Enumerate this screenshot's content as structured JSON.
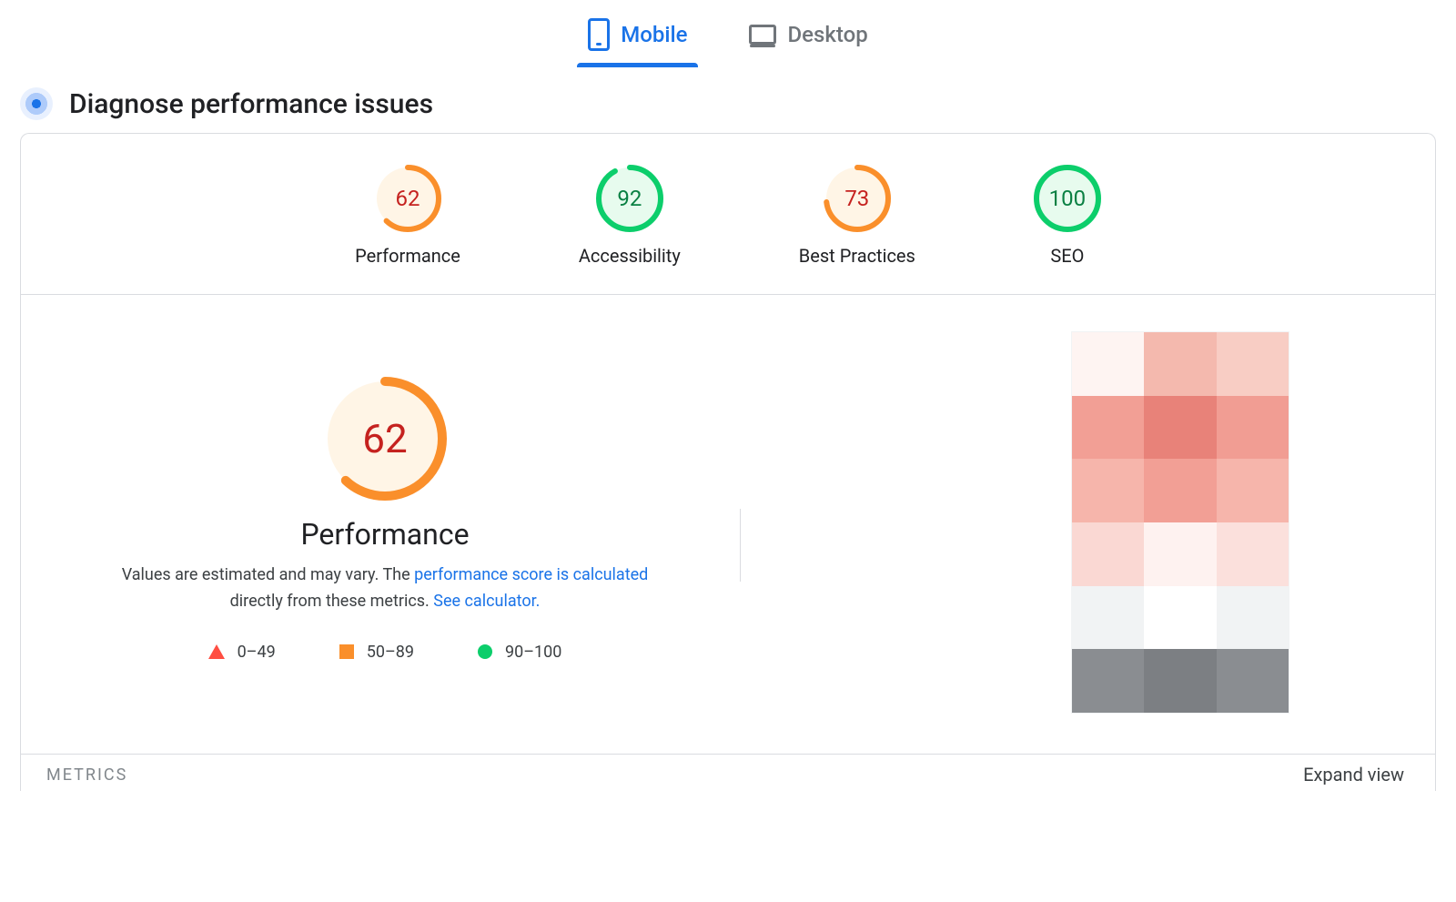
{
  "tabs": {
    "mobile": "Mobile",
    "desktop": "Desktop"
  },
  "section_title": "Diagnose performance issues",
  "gauges": [
    {
      "score": 62,
      "label": "Performance",
      "color": "#fa8f2b",
      "fill": "#fff5e6",
      "text": "#c5221f"
    },
    {
      "score": 92,
      "label": "Accessibility",
      "color": "#0cce6b",
      "fill": "#e7fbee",
      "text": "#0a8043"
    },
    {
      "score": 73,
      "label": "Best Practices",
      "color": "#fa8f2b",
      "fill": "#fff5e6",
      "text": "#c5221f"
    },
    {
      "score": 100,
      "label": "SEO",
      "color": "#0cce6b",
      "fill": "#e7fbee",
      "text": "#0a8043"
    }
  ],
  "perf": {
    "score": 62,
    "title": "Performance",
    "desc_prefix": "Values are estimated and may vary. The ",
    "desc_link1": "performance score is calculated",
    "desc_middle": " directly from these metrics. ",
    "desc_link2": "See calculator."
  },
  "legend": {
    "low": "0–49",
    "mid": "50–89",
    "high": "90–100"
  },
  "metrics": {
    "label": "Metrics",
    "expand": "Expand view"
  },
  "thumb_colors": [
    "#fef4f2",
    "#f4b9ae",
    "#f8cdc4",
    "#f29f95",
    "#e88279",
    "#f19d93",
    "#f6b5ab",
    "#f29f95",
    "#f6b5ab",
    "#fad8d3",
    "#fef2f0",
    "#fbe0dc",
    "#f1f3f4",
    "#ffffff",
    "#f1f3f4",
    "#8a8d91",
    "#7c7f83",
    "#8a8d91"
  ]
}
